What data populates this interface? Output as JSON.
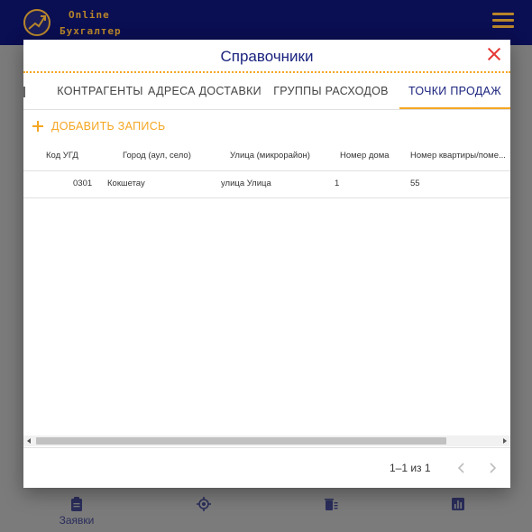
{
  "app": {
    "logo_line1": "Online",
    "logo_line2": "Бухгалтер",
    "brand_color": "#0a0e52",
    "accent_color": "#f5a623"
  },
  "bottom_nav": {
    "items": [
      {
        "label": "Заявки",
        "icon": "clipboard-icon"
      },
      {
        "label": "",
        "icon": "settings-icon"
      },
      {
        "label": "",
        "icon": "delete-list-icon"
      },
      {
        "label": "",
        "icon": "chart-icon"
      }
    ]
  },
  "dialog": {
    "title": "Справочники",
    "tabs": [
      {
        "label": "Контрагенты",
        "active": false
      },
      {
        "label": "Адреса доставки",
        "active": false
      },
      {
        "label": "Группы расходов",
        "active": false
      },
      {
        "label": "Точки продаж",
        "active": true
      }
    ],
    "add_button": "Добавить запись",
    "table": {
      "headers": [
        "Код УГД",
        "Город (аул, село)",
        "Улица (микрорайон)",
        "Номер дома",
        "Номер квартиры/поме..."
      ],
      "rows": [
        [
          "0301",
          "Кокшетау",
          "улица Улица",
          "1",
          "55"
        ]
      ]
    },
    "pagination": {
      "text": "1–1 из 1"
    }
  }
}
